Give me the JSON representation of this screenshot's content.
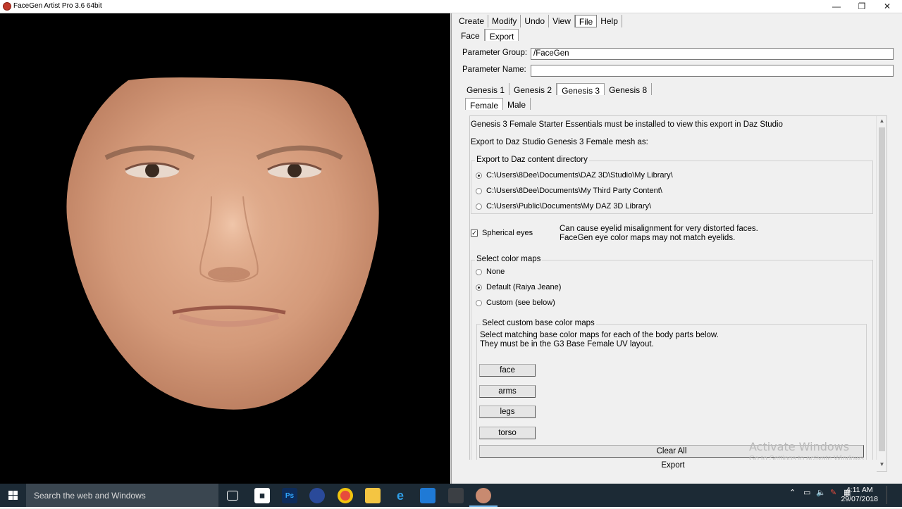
{
  "window": {
    "title": "FaceGen Artist Pro 3.6 64bit",
    "minimize": "—",
    "maximize": "❐",
    "close": "✕"
  },
  "menu": [
    {
      "label": "Create",
      "active": false
    },
    {
      "label": "Modify",
      "active": false
    },
    {
      "label": "Undo",
      "active": false
    },
    {
      "label": "View",
      "active": false
    },
    {
      "label": "File",
      "active": true
    },
    {
      "label": "Help",
      "active": false
    }
  ],
  "subtabs": [
    "Face",
    "Export"
  ],
  "params": {
    "group_label": "Parameter Group:",
    "group_value": "/FaceGen",
    "name_label": "Parameter Name:",
    "name_value": ""
  },
  "genesis_tabs": [
    "Genesis 1",
    "Genesis 2",
    "Genesis 3",
    "Genesis 8"
  ],
  "gender_tabs": [
    "Female",
    "Male"
  ],
  "content": {
    "requirement": "Genesis 3 Female Starter Essentials must be installed to view this export in Daz Studio",
    "export_as": "Export to Daz Studio Genesis 3 Female mesh as:",
    "dir_group_title": "Export to Daz content directory",
    "dirs": [
      "C:\\Users\\8Dee\\Documents\\DAZ 3D\\Studio\\My Library\\",
      "C:\\Users\\8Dee\\Documents\\My Third Party Content\\",
      "C:\\Users\\Public\\Documents\\My DAZ 3D Library\\"
    ],
    "spherical_eyes": "Spherical eyes",
    "spherical_note1": "Can cause eyelid misalignment for very distorted faces.",
    "spherical_note2": "FaceGen eye color maps may not match eyelids.",
    "color_group_title": "Select color maps",
    "color_options": [
      "None",
      "Default (Raiya Jeane)",
      "Custom (see below)"
    ],
    "custom_group_title": "Select custom base color maps",
    "custom_line1": "Select matching base color maps for each of the body parts below.",
    "custom_line2": "They must be in the G3 Base Female UV layout.",
    "body_buttons": [
      "face",
      "arms",
      "legs",
      "torso"
    ],
    "clear_all": "Clear All",
    "export": "Export"
  },
  "watermark": {
    "line1": "Activate Windows",
    "line2": "Go to Settings to activate Windows."
  },
  "taskbar": {
    "search_placeholder": "Search the web and Windows",
    "time": "4:11 AM",
    "date": "29/07/2018",
    "ps_label": "Ps"
  }
}
